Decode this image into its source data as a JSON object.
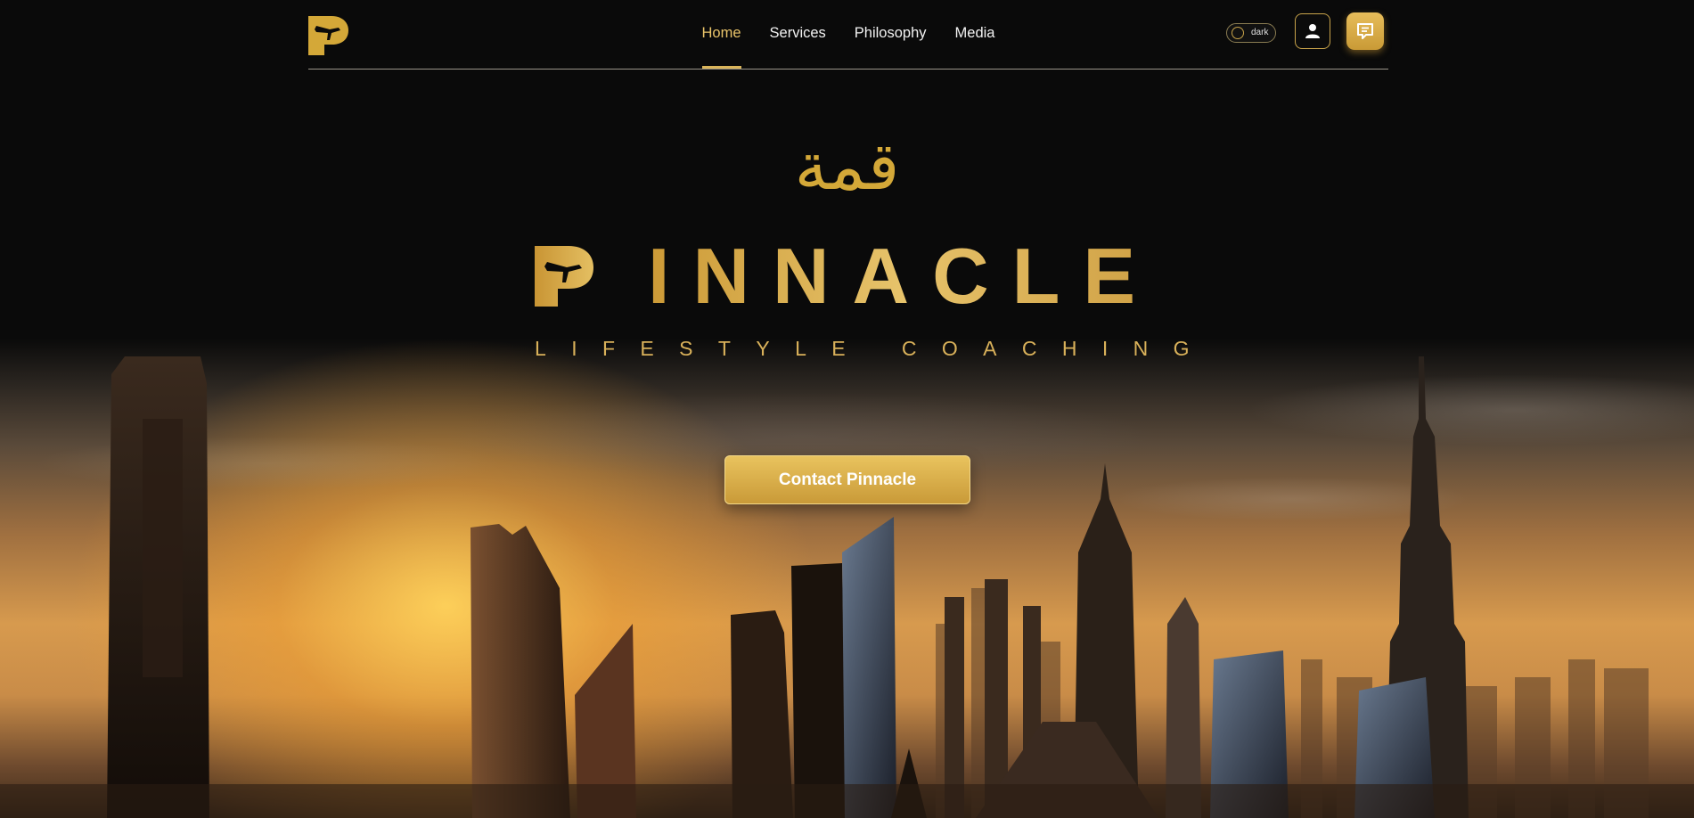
{
  "nav": {
    "items": [
      {
        "label": "Home",
        "active": true
      },
      {
        "label": "Services",
        "active": false
      },
      {
        "label": "Philosophy",
        "active": false
      },
      {
        "label": "Media",
        "active": false
      }
    ],
    "theme_toggle_label": "dark",
    "icons": {
      "logo": "pinnacle-p-plane-logo",
      "user": "user-icon",
      "chat": "chat-icon"
    }
  },
  "hero": {
    "arabic_title": "قمة",
    "brand_name": "INNACLE",
    "tagline": "LIFESTYLE COACHING",
    "cta_label": "Contact Pinnacle",
    "background": "city-skyline-sunset-image"
  },
  "colors": {
    "accent": "#d4a838",
    "background": "#0a0a0a",
    "text": "#f2f2f2"
  }
}
